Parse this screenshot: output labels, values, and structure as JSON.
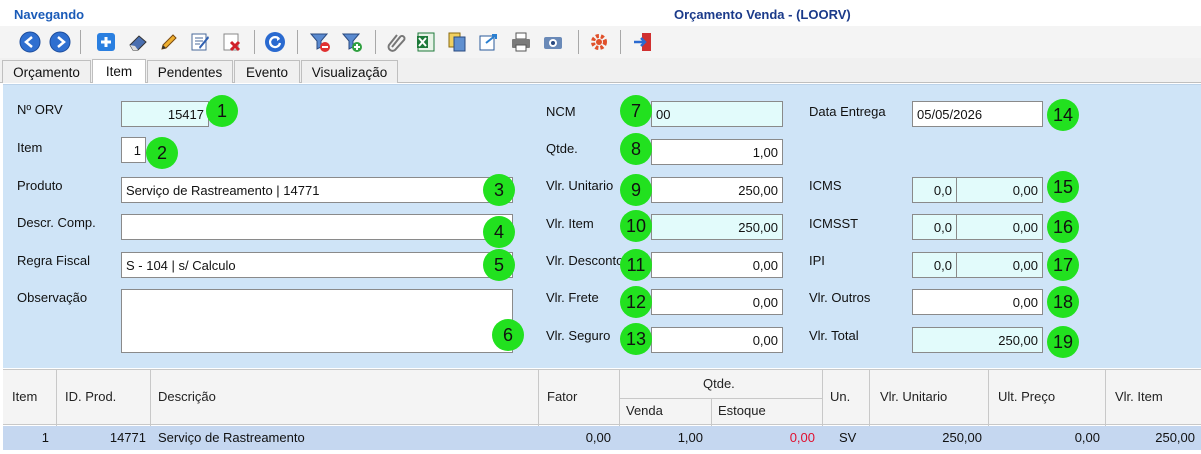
{
  "status": "Navegando",
  "window_title": "Orçamento Venda - (LOORV)",
  "toolbar": [
    {
      "icon": "nav-back-icon"
    },
    {
      "icon": "nav-forward-icon"
    },
    {
      "icon": "add-icon"
    },
    {
      "icon": "eraser-icon"
    },
    {
      "icon": "edit-pencil-icon"
    },
    {
      "icon": "edit-form-icon"
    },
    {
      "icon": "delete-icon"
    },
    {
      "icon": "refresh-icon"
    },
    {
      "icon": "filter-remove-icon"
    },
    {
      "icon": "filter-add-icon"
    },
    {
      "icon": "attach-icon"
    },
    {
      "icon": "excel-icon"
    },
    {
      "icon": "copy-icon"
    },
    {
      "icon": "export-icon"
    },
    {
      "icon": "print-icon"
    },
    {
      "icon": "preview-icon"
    },
    {
      "icon": "settings-icon"
    },
    {
      "icon": "exit-icon"
    }
  ],
  "tabs": [
    "Orçamento",
    "Item",
    "Pendentes",
    "Evento",
    "Visualização"
  ],
  "active_tab": "Item",
  "form": {
    "labels": {
      "norv": "Nº ORV",
      "item": "Item",
      "produto": "Produto",
      "descr": "Descr. Comp.",
      "regra": "Regra Fiscal",
      "obs": "Observação",
      "ncm": "NCM",
      "qtde": "Qtde.",
      "vunit": "Vlr. Unitario",
      "vitem": "Vlr. Item",
      "vdesc": "Vlr. Desconto",
      "vfrete": "Vlr. Frete",
      "vseguro": "Vlr. Seguro",
      "dataentrega": "Data Entrega",
      "icms": "ICMS",
      "icmsst": "ICMSST",
      "ipi": "IPI",
      "voutros": "Vlr. Outros",
      "vtotal": "Vlr. Total"
    },
    "values": {
      "norv": "15417",
      "item": "1",
      "produto": "Serviço de Rastreamento | 14771",
      "descr": "",
      "regra": "S - 104 | s/ Calculo",
      "obs": "",
      "ncm": "00",
      "qtde": "1,00",
      "vunit": "250,00",
      "vitem": "250,00",
      "vdesc": "0,00",
      "vfrete": "0,00",
      "vseguro": "0,00",
      "dataentrega": "05/05/2026",
      "icms_pct": "0,0",
      "icms_val": "0,00",
      "icmsst_pct": "0,0",
      "icmsst_val": "0,00",
      "ipi_pct": "0,0",
      "ipi_val": "0,00",
      "voutros": "0,00",
      "vtotal": "250,00"
    },
    "badges": [
      "1",
      "2",
      "3",
      "4",
      "5",
      "6",
      "7",
      "8",
      "9",
      "10",
      "11",
      "12",
      "13",
      "14",
      "15",
      "16",
      "17",
      "18",
      "19"
    ]
  },
  "grid": {
    "headers": {
      "item": "Item",
      "idprod": "ID. Prod.",
      "descricao": "Descrição",
      "fator": "Fator",
      "qtde": "Qtde.",
      "venda": "Venda",
      "estoque": "Estoque",
      "un": "Un.",
      "vunit": "Vlr. Unitario",
      "ultpreco": "Ult. Preço",
      "vitem": "Vlr. Item"
    },
    "rows": [
      {
        "item": "1",
        "idprod": "14771",
        "descricao": "Serviço de Rastreamento",
        "fator": "0,00",
        "venda": "1,00",
        "estoque": "0,00",
        "un": "SV",
        "vunit": "250,00",
        "ultpreco": "0,00",
        "vitem": "250,00"
      }
    ]
  },
  "colors": {
    "form_bg": "#cfe4f7",
    "readonly_field": "#e2fbfb",
    "badge": "#22e11f",
    "selected_row": "#c5d7f0",
    "negative_stock": "#e0102f",
    "title_blue": "#1a3a8a"
  }
}
